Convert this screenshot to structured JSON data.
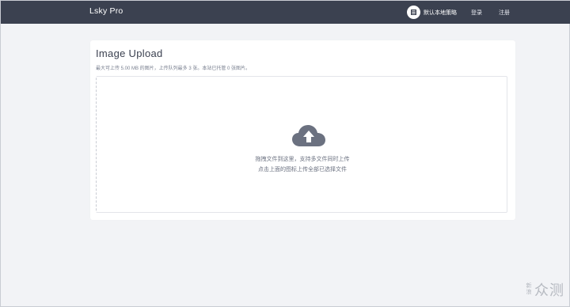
{
  "header": {
    "brand": "Lsky Pro",
    "strategy_label": "默认本地策略",
    "login": "登录",
    "register": "注册"
  },
  "upload": {
    "title": "Image Upload",
    "subtitle": "最大可上传 5.00 MB 的图片，上传队列最多 3 张。本站已托管 0 张图片。",
    "drop_line1": "拖拽文件到这里，支持多文件同时上传",
    "drop_line2": "点击上面的图标上传全部已选择文件",
    "icon": "cloud-upload-icon"
  },
  "watermark": {
    "small": "新浪",
    "big": "众测"
  },
  "colors": {
    "topbar": "#3b4150",
    "page_bg": "#f2f3f6",
    "icon_gray": "#6b7180"
  }
}
